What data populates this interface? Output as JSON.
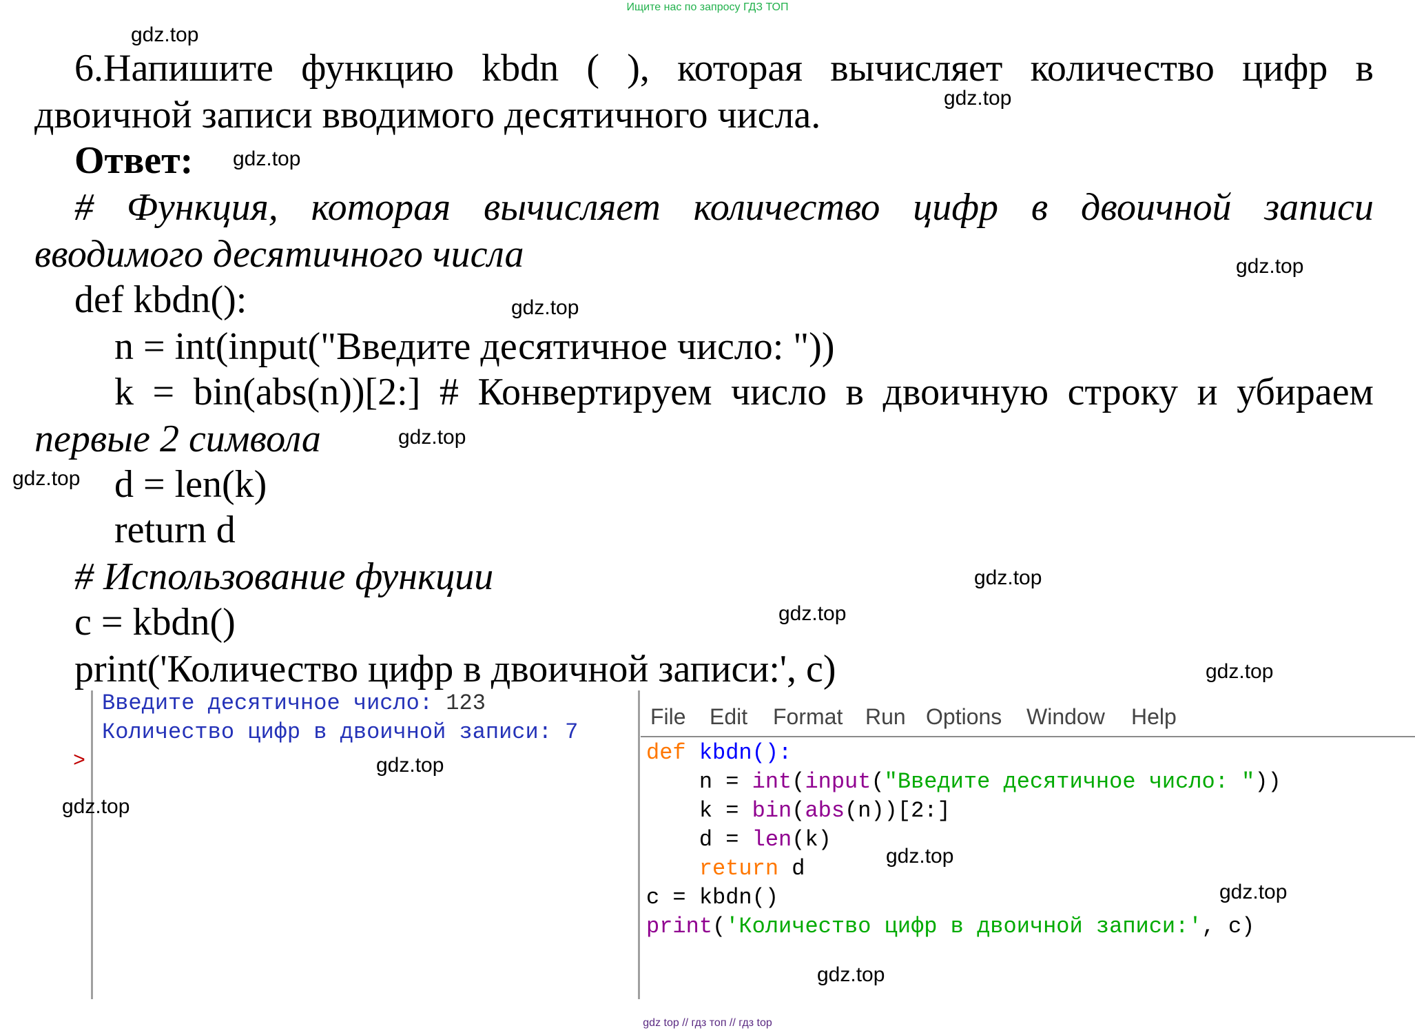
{
  "banner_top": "Ищите нас по запросу ГДЗ ТОП",
  "banner_bottom": "gdz top  //  гдз топ  //  гдз top",
  "watermark": "gdz.top",
  "task": {
    "line1": "6.Напишите функцию kbdn ( ), которая вычисляет количество цифр в",
    "line2": "двоичной записи вводимого десятичного числа."
  },
  "answer_label": "Ответ:",
  "answer": {
    "comment1_line1": "# Функция, которая вычисляет количество цифр в двоичной записи",
    "comment1_line2": "вводимого десятичного числа",
    "def_line": "def kbdn():",
    "n_line": "n = int(input(\"Введите десятичное число: \"))",
    "k_line": "k = bin(abs(n))[2:] # Конвертируем число в двоичную строку и убираем",
    "k_line_cont": "первые 2 символа",
    "d_line": "d = len(k)",
    "return_line": "return d",
    "comment2": "# Использование функции",
    "c_line": "c = kbdn()",
    "print_line": "print('Количество цифр в двоичной записи:', c)"
  },
  "shell": {
    "line1_prompt": "Введите десятичное число: ",
    "line1_value": "123",
    "line2_text": "Количество цифр в двоичной записи: ",
    "line2_value": "7",
    "prompt_symbol": ">"
  },
  "editor": {
    "menu": [
      "File",
      "Edit",
      "Format",
      "Run",
      "Options",
      "Window",
      "Help"
    ],
    "code": {
      "l1_def": "def",
      "l1_rest": " kbdn():",
      "l2_a": "    n = ",
      "l2_int": "int",
      "l2_b": "(",
      "l2_input": "input",
      "l2_c": "(",
      "l2_str": "\"Введите десятичное число: \"",
      "l2_d": "))",
      "l3_a": "    k = ",
      "l3_bin": "bin",
      "l3_b": "(",
      "l3_abs": "abs",
      "l3_c": "(n))[2:]",
      "l4_a": "    d = ",
      "l4_len": "len",
      "l4_b": "(k)",
      "l5_a": "    ",
      "l5_return": "return",
      "l5_b": " d",
      "l6": "c = kbdn()",
      "l7_print": "print",
      "l7_a": "(",
      "l7_str": "'Количество цифр в двоичной записи:'",
      "l7_b": ", c)"
    }
  },
  "colors": {
    "banner_top": "#22b14c",
    "banner_bottom": "#5a2a82",
    "keyword": "#ff7700",
    "builtin": "#900090",
    "string": "#00aa00",
    "function_name": "#0000ff",
    "shell_text": "#2432b8",
    "prompt": "#c00000"
  }
}
